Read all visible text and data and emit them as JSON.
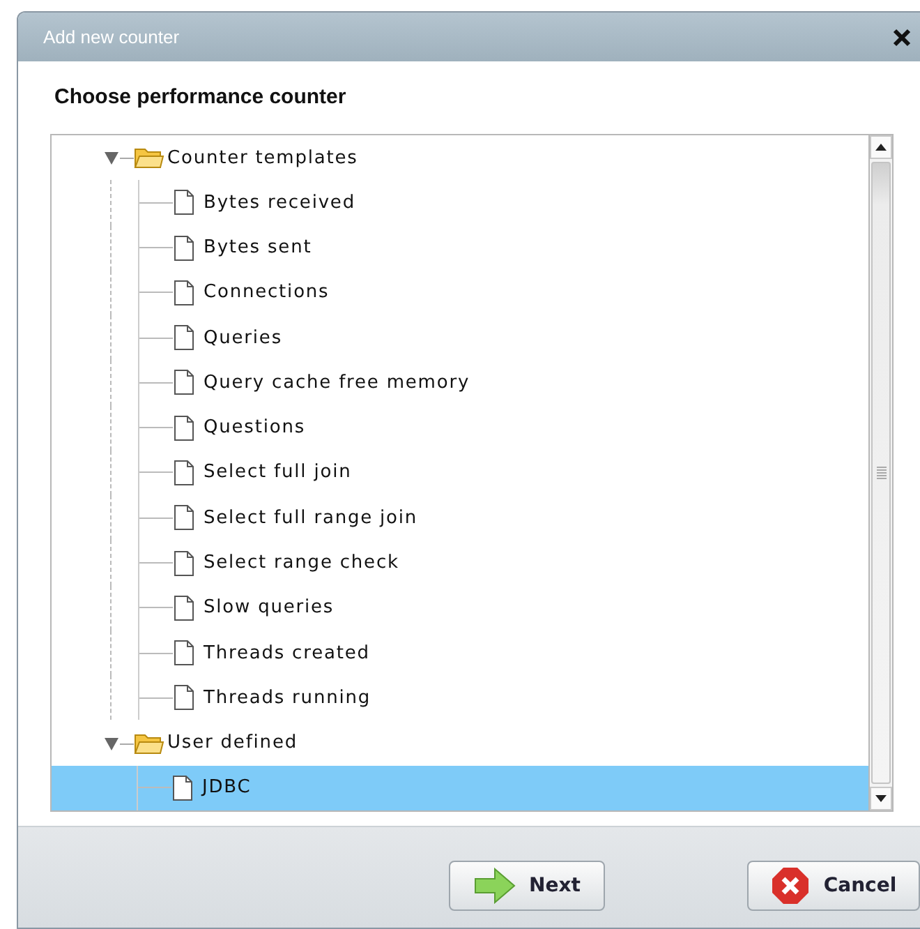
{
  "window": {
    "title": "Add new counter"
  },
  "heading": "Choose performance counter",
  "tree": [
    {
      "label": "Counter templates",
      "expanded": true,
      "children": [
        {
          "label": "Bytes received",
          "selected": false
        },
        {
          "label": "Bytes sent",
          "selected": false
        },
        {
          "label": "Connections",
          "selected": false
        },
        {
          "label": "Queries",
          "selected": false
        },
        {
          "label": "Query cache free memory",
          "selected": false
        },
        {
          "label": "Questions",
          "selected": false
        },
        {
          "label": "Select full join",
          "selected": false
        },
        {
          "label": "Select full range join",
          "selected": false
        },
        {
          "label": "Select range check",
          "selected": false
        },
        {
          "label": "Slow queries",
          "selected": false
        },
        {
          "label": "Threads created",
          "selected": false
        },
        {
          "label": "Threads running",
          "selected": false
        }
      ]
    },
    {
      "label": "User defined",
      "expanded": true,
      "children": [
        {
          "label": "JDBC",
          "selected": true
        }
      ]
    }
  ],
  "buttons": [
    {
      "kind": "next",
      "label": "Next"
    },
    {
      "kind": "cancel",
      "label": "Cancel"
    }
  ]
}
